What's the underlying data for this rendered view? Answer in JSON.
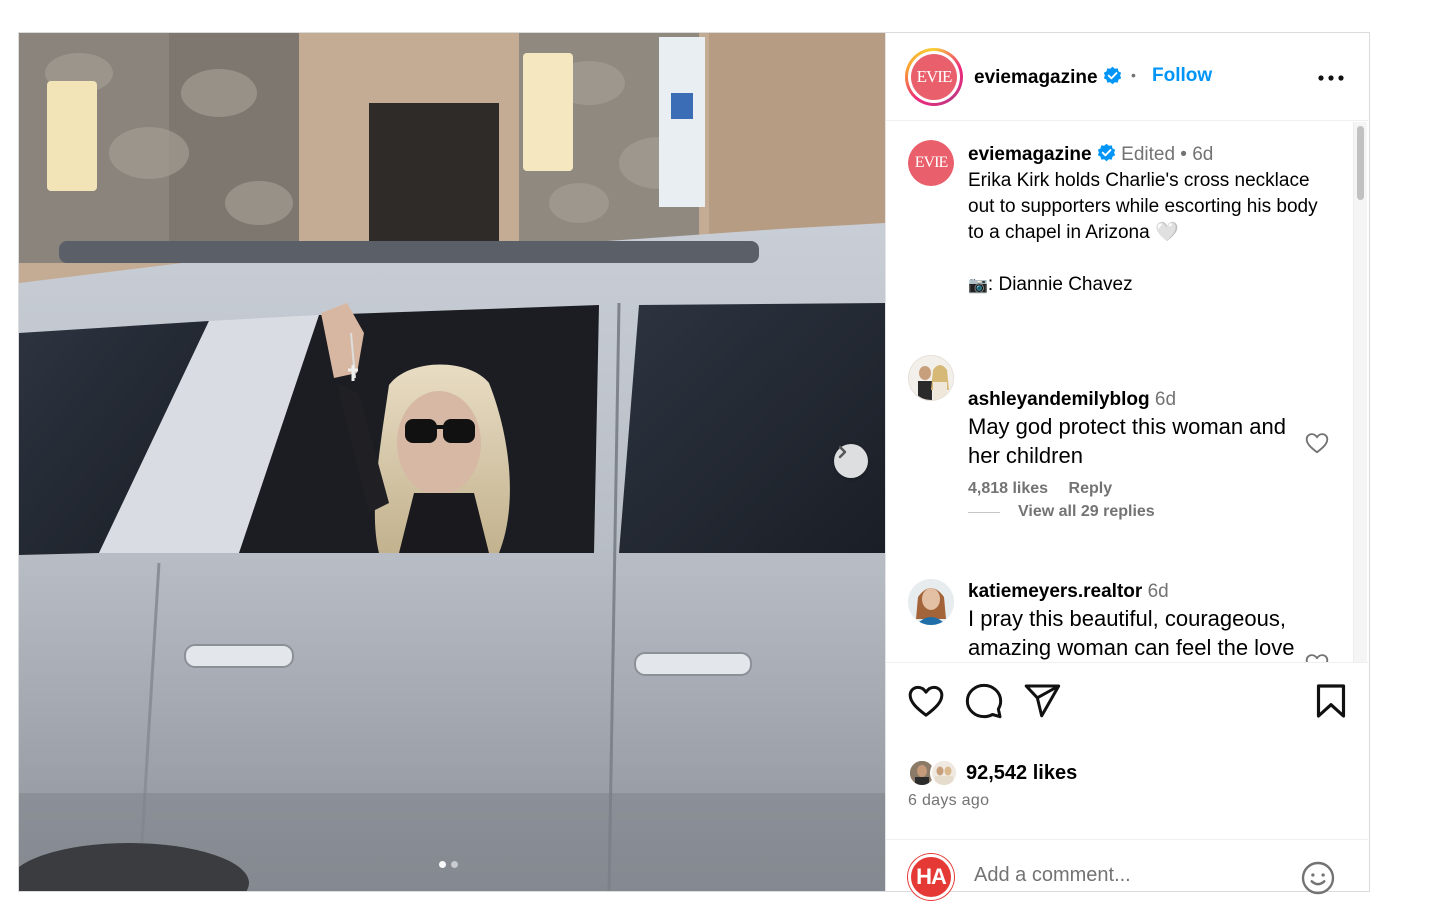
{
  "photo": {
    "next_icon": "chevron-right-icon",
    "slide_count": 2,
    "active_slide": 1
  },
  "header": {
    "logo_text": "EVIE",
    "username": "eviemagazine",
    "separator": "•",
    "follow_label": "Follow",
    "more_icon": "more-horizontal-icon"
  },
  "caption": {
    "logo_text": "EVIE",
    "username": "eviemagazine",
    "edited": "Edited",
    "dot": "•",
    "age": "6d",
    "text": "Erika Kirk holds Charlie's cross necklace out to supporters while escorting his body to a chapel in Arizona 🤍",
    "camera_emoji": "📷",
    "credit": ": Diannie Chavez"
  },
  "comments": [
    {
      "username": "ashleyandemilyblog",
      "age": "6d",
      "text": "May god protect this woman and her children",
      "likes": "4,818 likes",
      "reply_label": "Reply",
      "view_replies": "View all 29 replies"
    },
    {
      "username": "katiemeyers.realtor",
      "age": "6d",
      "text": "I pray this beautiful, courageous, amazing woman can feel the love of an entire"
    }
  ],
  "actions": {
    "like_icon": "heart-icon",
    "comment_icon": "comment-icon",
    "share_icon": "send-icon",
    "save_icon": "bookmark-icon",
    "likes_count": "92,542 likes",
    "time_ago": "6 days ago"
  },
  "add_comment": {
    "avatar_text": "HA",
    "placeholder": "Add a comment...",
    "emoji_icon": "smiley-icon"
  },
  "colors": {
    "accent_blue": "#0095f6",
    "evie_pink": "#e95f6c",
    "muted_text": "#737373"
  }
}
